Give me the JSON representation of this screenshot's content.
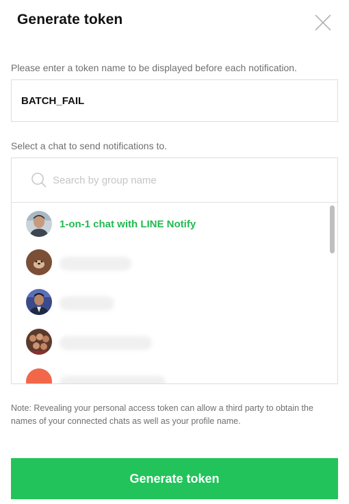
{
  "dialog": {
    "title": "Generate token"
  },
  "token": {
    "label": "Please enter a token name to be displayed before each notification.",
    "value": "BATCH_FAIL"
  },
  "chat_select": {
    "label": "Select a chat to send notifications to.",
    "search_placeholder": "Search by group name",
    "items": [
      {
        "name": "1-on-1 chat with LINE Notify",
        "avatar": "person-photo-avatar"
      },
      {
        "name": "",
        "avatar": "brown-bear-avatar"
      },
      {
        "name": "",
        "avatar": "person-suit-avatar"
      },
      {
        "name": "",
        "avatar": "group-photo-avatar"
      },
      {
        "name": "",
        "avatar": "orange-avatar"
      }
    ]
  },
  "note": "Note: Revealing your personal access token can allow a third party to obtain the names of your connected chats as well as your profile name.",
  "actions": {
    "generate_label": "Generate token"
  },
  "colors": {
    "accent": "#22c35a",
    "chat_name": "#22b951",
    "text_muted": "#6f6f6f",
    "border": "#dcdcdc"
  }
}
